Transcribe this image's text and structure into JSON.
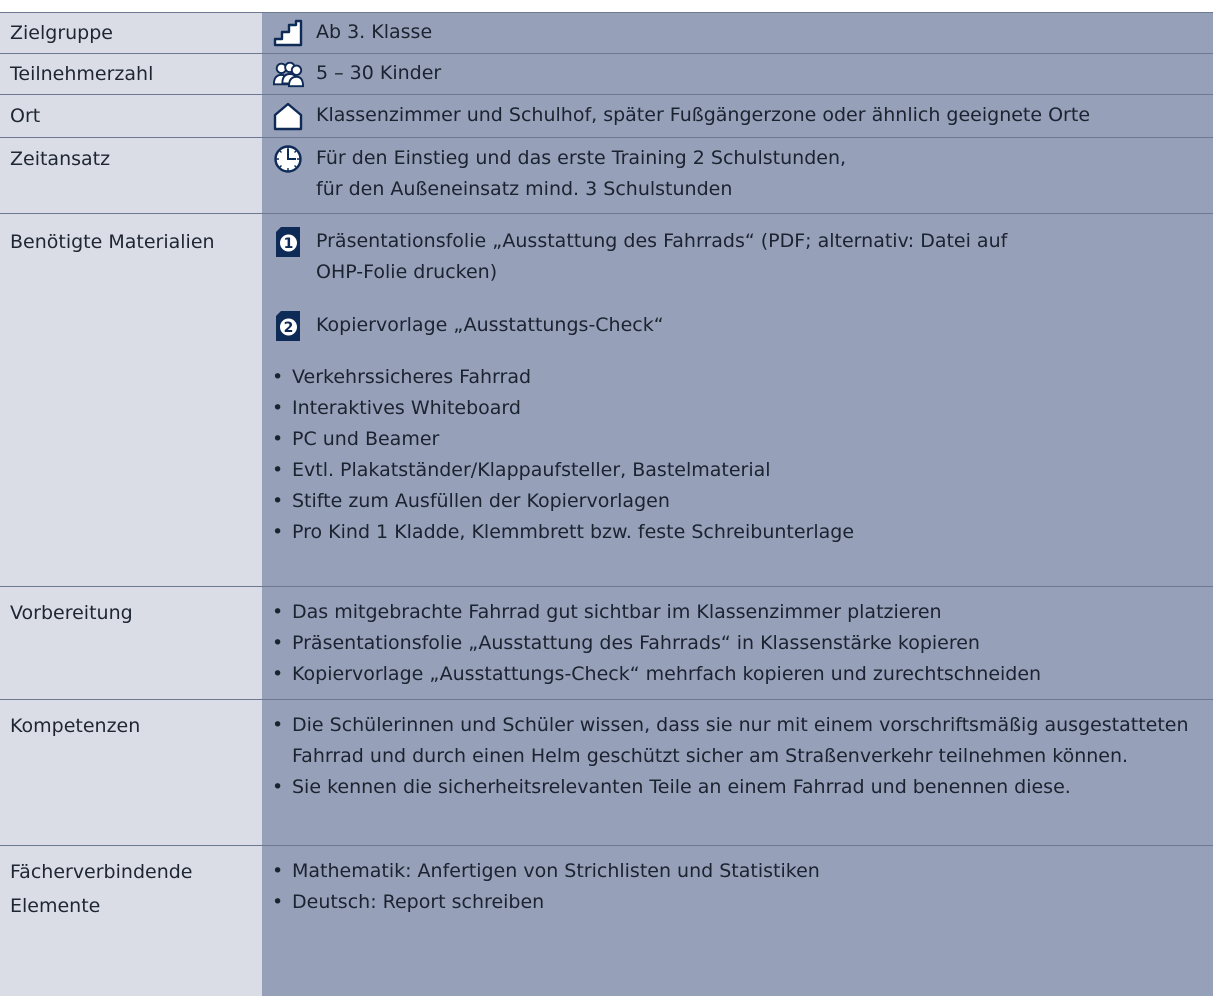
{
  "rows": {
    "zielgruppe": {
      "label": "Zielgruppe",
      "value": "Ab 3. Klasse",
      "icon": "stairs-icon"
    },
    "teilnehmerzahl": {
      "label": "Teilnehmerzahl",
      "value": "5 – 30 Kinder",
      "icon": "people-group-icon"
    },
    "ort": {
      "label": "Ort",
      "value": "Klassenzimmer und Schulhof, später Fußgängerzone oder ähnlich geeignete Orte",
      "icon": "house-icon"
    },
    "zeitansatz": {
      "label": "Zeitansatz",
      "line1": "Für den Einstieg und das erste Training 2 Schulstunden,",
      "line2": "für den Außeneinsatz mind. 3 Schulstunden",
      "icon": "clock-icon"
    },
    "materialien": {
      "label": "Benötigte Materialien",
      "doc1": {
        "badge": "1",
        "line1": "Präsentationsfolie „Ausstattung des Fahrrads“ (PDF; alternativ: Datei auf",
        "line2": "OHP-Folie drucken)",
        "icon": "document-1-icon"
      },
      "doc2": {
        "badge": "2",
        "text": "Kopiervorlage „Ausstattungs-Check“",
        "icon": "document-2-icon"
      },
      "items": [
        "Verkehrssicheres Fahrrad",
        "Interaktives Whiteboard",
        "PC und Beamer",
        "Evtl. Plakatständer/Klappaufsteller, Bastelmaterial",
        "Stifte zum Ausfüllen der Kopiervorlagen",
        "Pro Kind 1 Kladde, Klemmbrett bzw. feste Schreibunterlage"
      ]
    },
    "vorbereitung": {
      "label": "Vorbereitung",
      "items": [
        "Das mitgebrachte Fahrrad gut sichtbar im Klassenzimmer platzieren",
        "Präsentationsfolie „Ausstattung des Fahrrads“ in Klassenstärke kopieren",
        "Kopiervorlage „Ausstattungs-Check“ mehrfach kopieren und zurechtschneiden"
      ]
    },
    "kompetenzen": {
      "label": "Kompetenzen",
      "item1": {
        "line1": "Die Schülerinnen und Schüler wissen, dass sie nur mit einem vorschriftsmäßig",
        "line2": "ausgestatteten Fahrrad und durch einen Helm geschützt sicher am Straßenverkehr",
        "line3": "teilnehmen können."
      },
      "item2": "Sie kennen die sicherheitsrelevanten Teile an einem Fahrrad und benennen diese."
    },
    "faecher": {
      "label_line1": "Fächerverbindende",
      "label_line2": "Elemente",
      "items": [
        "Mathematik: Anfertigen von Strichlisten und Statistiken",
        "Deutsch: Report schreiben"
      ]
    }
  },
  "colors": {
    "label_bg": "#dadde5",
    "content_bg": "#97a0b9",
    "icon_dark": "#0e2a57"
  }
}
